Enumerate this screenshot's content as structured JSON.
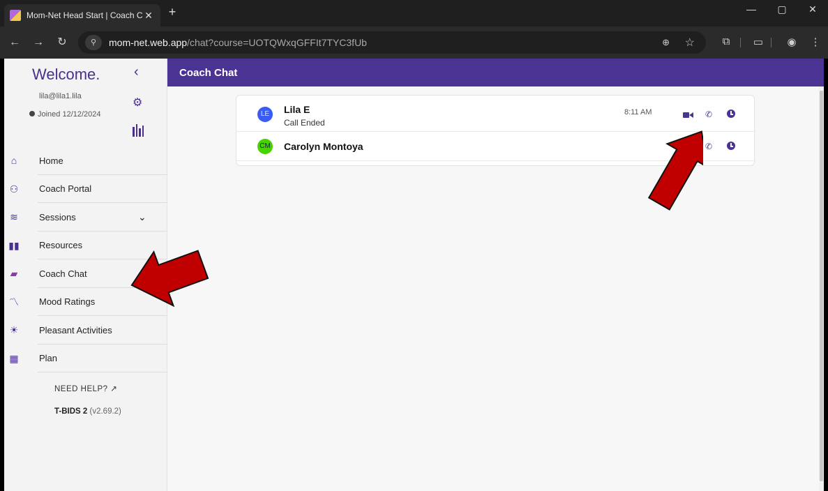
{
  "browser": {
    "tab_title": "Mom-Net Head Start | Coach C",
    "tab_close": "✕",
    "new_tab": "+",
    "url_host": "mom-net.web.app",
    "url_path": "/chat?course=UOTQWxqGFFIt7TYC3fUb",
    "site_info_icon": "tune-icon",
    "window_controls": [
      "—",
      "▢",
      "✕"
    ]
  },
  "sidebar": {
    "welcome": "Welcome.",
    "collapse_icon": "‹",
    "email": "lila@lila1.lila",
    "joined": "Joined 12/12/2024",
    "nav": [
      {
        "label": "Home",
        "icon": "home-icon",
        "glyph": "⌂"
      },
      {
        "label": "Coach Portal",
        "icon": "users-icon",
        "glyph": "👥"
      },
      {
        "label": "Sessions",
        "icon": "layers-icon",
        "glyph": "≋"
      },
      {
        "label": "Resources",
        "icon": "book-icon",
        "glyph": "▮▮"
      },
      {
        "label": "Coach Chat",
        "icon": "chat-icon",
        "glyph": "▬"
      },
      {
        "label": "Mood Ratings",
        "icon": "chart-line-icon",
        "glyph": "〽"
      },
      {
        "label": "Pleasant Activities",
        "icon": "sun-icon",
        "glyph": "☀"
      },
      {
        "label": "Plan",
        "icon": "calendar-icon",
        "glyph": "▦"
      }
    ],
    "sessions_chevron": "⌄",
    "need_help": "NEED HELP? ↗",
    "version_name": "T-BIDS 2",
    "version_num": "(v2.69.2)"
  },
  "header": {
    "title": "Coach Chat"
  },
  "chats": [
    {
      "initials": "LE",
      "name": "Lila E",
      "subtitle": "Call Ended",
      "time": "8:11 AM"
    },
    {
      "initials": "CM",
      "name": "Carolyn Montoya",
      "subtitle": "",
      "time": ""
    }
  ],
  "colors": {
    "brand": "#4b3393",
    "arrow": "#c00000"
  }
}
